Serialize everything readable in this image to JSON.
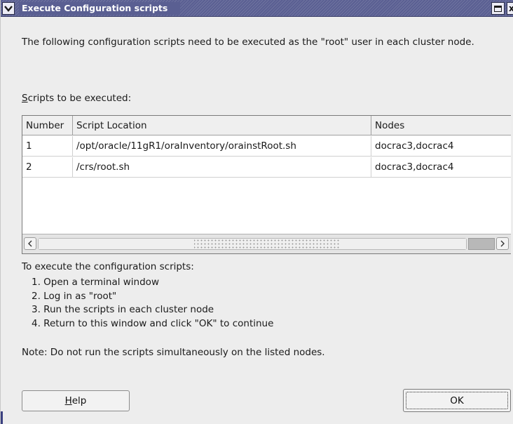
{
  "window": {
    "title": "Execute Configuration scripts",
    "title_accent_color": "#5a5f92",
    "menu_icon": "chevron-down-icon",
    "maximize_icon": "maximize-icon",
    "close_icon": "close-icon",
    "close_glyph": "x"
  },
  "intro_text": "The following configuration scripts need to be executed as the \"root\" user in each cluster node.",
  "scripts_label": {
    "mnemonic": "S",
    "rest": "cripts to be executed:"
  },
  "table": {
    "columns": [
      "Number",
      "Script Location",
      "Nodes"
    ],
    "rows": [
      {
        "number": "1",
        "location": "/opt/oracle/11gR1/oraInventory/orainstRoot.sh",
        "nodes": "docrac3,docrac4"
      },
      {
        "number": "2",
        "location": "/crs/root.sh",
        "nodes": "docrac3,docrac4"
      }
    ],
    "scrollbar": {
      "left_icon": "arrow-left-icon",
      "right_icon": "arrow-right-icon"
    }
  },
  "instructions": {
    "title": "To execute the configuration scripts:",
    "steps": [
      "1. Open a terminal window",
      "2. Log in as \"root\"",
      "3. Run the scripts in each cluster node",
      "4. Return to this window and click \"OK\" to continue"
    ]
  },
  "note": "Note: Do not run the scripts simultaneously on the listed nodes.",
  "buttons": {
    "help": {
      "mnemonic": "H",
      "rest": "elp"
    },
    "ok": "OK"
  }
}
